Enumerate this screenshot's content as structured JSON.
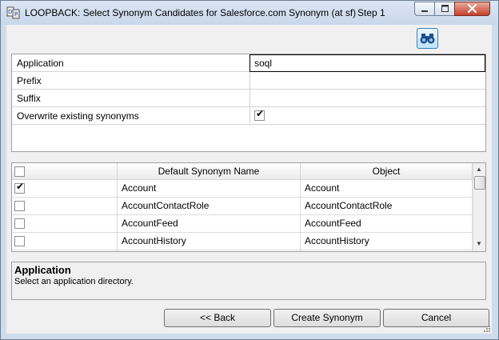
{
  "window": {
    "title": "LOOPBACK: Select Synonym Candidates for Salesforce.com Synonym (at sf)",
    "step": "Step 1",
    "icons": {
      "app": "synonym-app-icon",
      "minimize": "minimize-icon",
      "maximize": "maximize-icon",
      "close": "close-icon"
    }
  },
  "toolbar": {
    "find_icon": "binoculars-icon"
  },
  "properties": [
    {
      "label": "Application",
      "value": "soql",
      "type": "text",
      "active": true
    },
    {
      "label": "Prefix",
      "value": "",
      "type": "text",
      "active": false
    },
    {
      "label": "Suffix",
      "value": "",
      "type": "text",
      "active": false
    },
    {
      "label": "Overwrite existing synonyms",
      "type": "checkbox",
      "checked": true,
      "mark": "✔"
    }
  ],
  "grid": {
    "columns": [
      "",
      "Default Synonym Name",
      "Object"
    ],
    "select_all_checked": false,
    "rows": [
      {
        "checked": true,
        "mark": "✔",
        "name": "Account",
        "object": "Account"
      },
      {
        "checked": false,
        "mark": "",
        "name": "AccountContactRole",
        "object": "AccountContactRole"
      },
      {
        "checked": false,
        "mark": "",
        "name": "AccountFeed",
        "object": "AccountFeed"
      },
      {
        "checked": false,
        "mark": "",
        "name": "AccountHistory",
        "object": "AccountHistory"
      },
      {
        "checked": false,
        "mark": "",
        "name": "",
        "object": ""
      }
    ],
    "scroll_up": "▲",
    "scroll_down": "▼"
  },
  "help": {
    "title": "Application",
    "text": "Select an application directory."
  },
  "buttons": {
    "back": "<< Back",
    "create": "Create Synonym",
    "cancel": "Cancel"
  },
  "colors": {
    "title_bar": "#c9d7ea",
    "close_button": "#c4412a",
    "dialog_bg": "#f0f0f0",
    "find_button": "#bfe3f9"
  }
}
